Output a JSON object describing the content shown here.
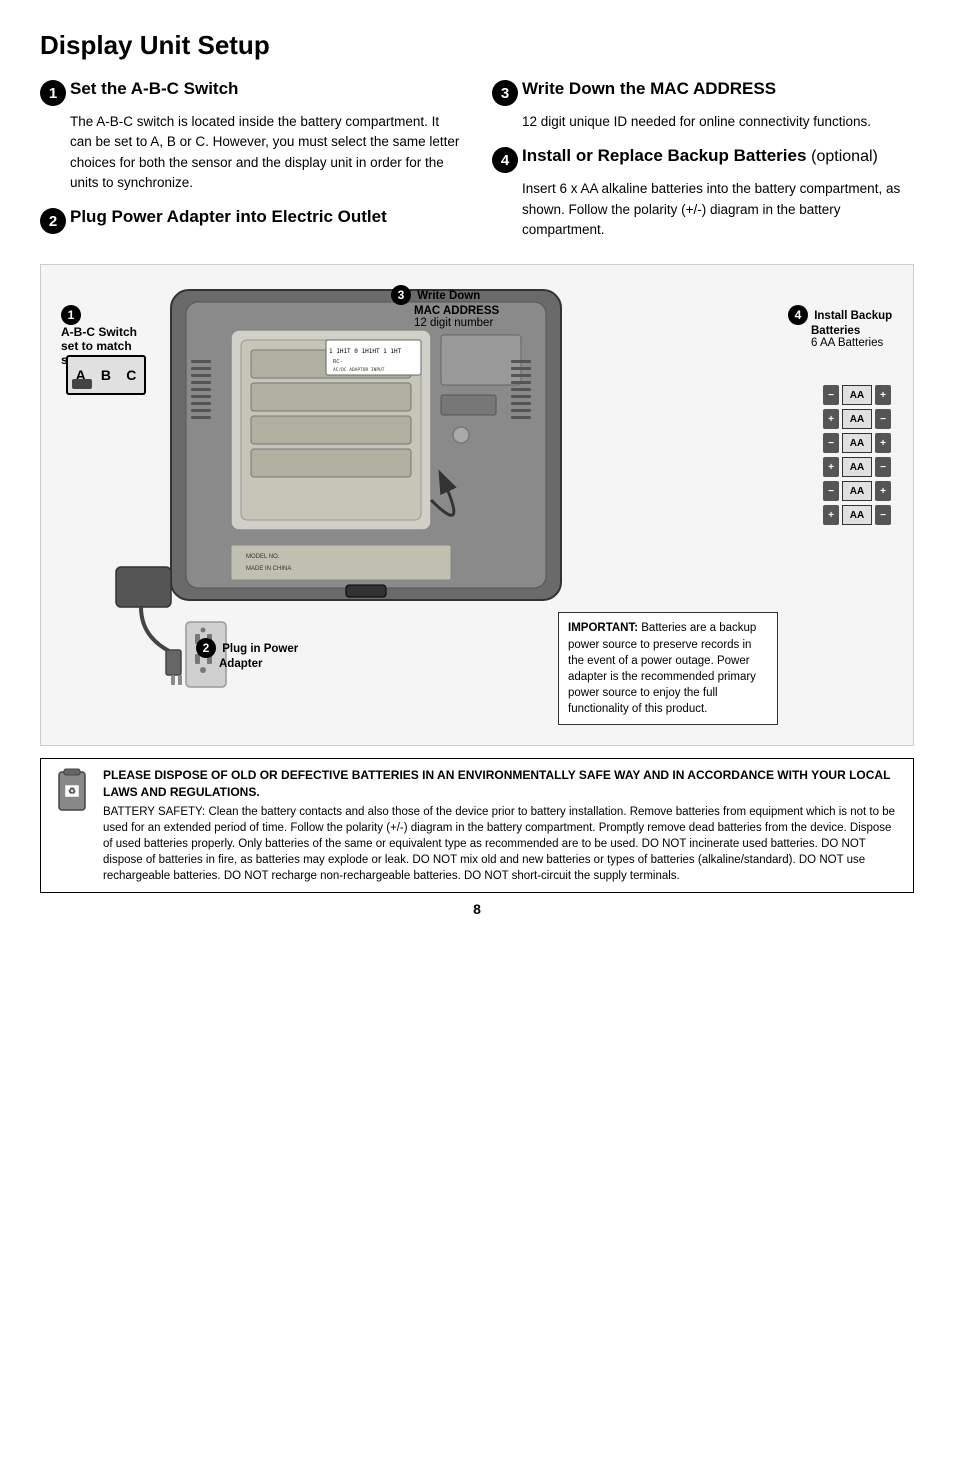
{
  "page": {
    "title": "Display Unit Setup",
    "page_number": "8"
  },
  "steps": {
    "step1": {
      "number": "1",
      "title": "Set the A-B-C Switch",
      "body": "The A-B-C switch is located inside the battery compartment. It can be set to A, B or C. However, you must select the same letter choices for both the sensor and the display unit in order for the units to synchronize."
    },
    "step2": {
      "number": "2",
      "title": "Plug Power Adapter into Electric Outlet",
      "body": ""
    },
    "step3": {
      "number": "3",
      "title": "Write Down the MAC ADDRESS",
      "body": "12 digit unique ID needed for online connectivity functions."
    },
    "step4": {
      "number": "4",
      "title_part1": "Install or Replace Backup",
      "title_part2": "Batteries",
      "title_optional": "(optional)",
      "body": "Insert 6 x AA alkaline batteries into the battery compartment, as shown. Follow the polarity (+/-) diagram in the battery compartment."
    }
  },
  "diagram": {
    "abc_callout_line1": "A-B-C Switch",
    "abc_callout_line2": "set to match",
    "abc_callout_line3": "sensor",
    "abc_labels": [
      "A",
      "B",
      "C"
    ],
    "mac_callout_line1": "Write Down",
    "mac_callout_line2": "MAC ADDRESS",
    "mac_callout_line3": "12 digit number",
    "battery_right_line1": "Install Backup",
    "battery_right_line2": "Batteries",
    "battery_right_line3": "6 AA Batteries",
    "battery_rows": [
      {
        "left": "−",
        "label": "AA",
        "right": "+"
      },
      {
        "left": "+",
        "label": "AA",
        "right": "−"
      },
      {
        "left": "−",
        "label": "AA",
        "right": "+"
      },
      {
        "left": "+",
        "label": "AA",
        "right": "−"
      },
      {
        "left": "−",
        "label": "AA",
        "right": "+"
      },
      {
        "left": "+",
        "label": "AA",
        "right": "−"
      }
    ],
    "power_callout_line1": "Plug in Power",
    "power_callout_line2": "Adapter",
    "important_label": "IMPORTANT:",
    "important_text": "Batteries are a backup power source to preserve records in the event of a power outage. Power adapter is the recommended primary power source to enjoy the full functionality of this product."
  },
  "disposal": {
    "title": "PLEASE DISPOSE OF OLD OR DEFECTIVE BATTERIES IN AN ENVIRONMENTALLY SAFE WAY AND IN ACCORDANCE WITH YOUR LOCAL LAWS AND REGULATIONS.",
    "body": "BATTERY SAFETY: Clean the battery contacts and also those of the device prior to battery installation. Remove batteries from equipment which is not to be used for an extended period of time. Follow the polarity (+/-) diagram in the battery compartment. Promptly remove dead batteries from the device. Dispose of used batteries properly. Only batteries of the same or equivalent type as recommended are to be used. DO NOT incinerate used batteries. DO NOT dispose of batteries in fire, as batteries may explode or leak. DO NOT mix old and new batteries or types of batteries (alkaline/standard). DO NOT use rechargeable batteries. DO NOT recharge non-rechargeable batteries. DO NOT short-circuit the supply terminals."
  }
}
